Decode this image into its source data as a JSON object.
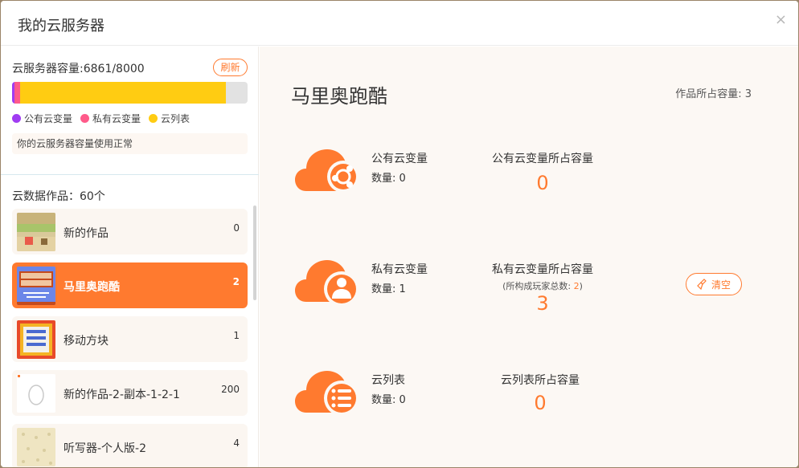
{
  "dialog": {
    "title": "我的云服务器",
    "close_glyph": "×"
  },
  "capacity": {
    "label": "云服务器容量:6861/8000",
    "refresh_label": "刷新",
    "used": 6861,
    "total": 8000,
    "segments": [
      {
        "name": "公有云变量",
        "value": 0.011,
        "color": "#a03cf2"
      },
      {
        "name": "私有云变量",
        "value": 0.023,
        "color": "#ff5a8a"
      },
      {
        "name": "云列表",
        "value": 0.874,
        "color": "#ffcc12"
      }
    ],
    "status": "你的云服务器容量使用正常"
  },
  "works": {
    "label": "云数据作品：60个",
    "items": [
      {
        "name": "新的作品",
        "count": "0",
        "active": false,
        "thumb": "grass-scene"
      },
      {
        "name": "马里奥跑酷",
        "count": "2",
        "active": true,
        "thumb": "mario-title"
      },
      {
        "name": "移动方块",
        "count": "1",
        "active": false,
        "thumb": "block-menu"
      },
      {
        "name": "新的作品-2-副本-1-2-1",
        "count": "200",
        "active": false,
        "thumb": "egg"
      },
      {
        "name": "听写器-个人版-2",
        "count": "4",
        "active": false,
        "thumb": "pattern"
      }
    ]
  },
  "detail": {
    "title": "马里奥跑酷",
    "capacity_label": "作品所占容量: 3",
    "rows": [
      {
        "icon": "cloud-share-icon",
        "type": "公有云变量",
        "qty": "数量: 0",
        "cap_title": "公有云变量所占容量",
        "cap_sub_prefix": "",
        "cap_sub_value": "",
        "cap_sub_suffix": "",
        "cap_value": "0"
      },
      {
        "icon": "cloud-user-icon",
        "type": "私有云变量",
        "qty": "数量: 1",
        "cap_title": "私有云变量所占容量",
        "cap_sub_prefix": "(所构成玩家总数: ",
        "cap_sub_value": "2",
        "cap_sub_suffix": ")",
        "cap_value": "3",
        "clear_label": "清空"
      },
      {
        "icon": "cloud-list-icon",
        "type": "云列表",
        "qty": "数量: 0",
        "cap_title": "云列表所占容量",
        "cap_sub_prefix": "",
        "cap_sub_value": "",
        "cap_sub_suffix": "",
        "cap_value": "0"
      }
    ]
  },
  "colors": {
    "accent": "#ff7a2f",
    "panel_bg": "#fcf8f4",
    "item_bg": "#fbf6f1"
  }
}
